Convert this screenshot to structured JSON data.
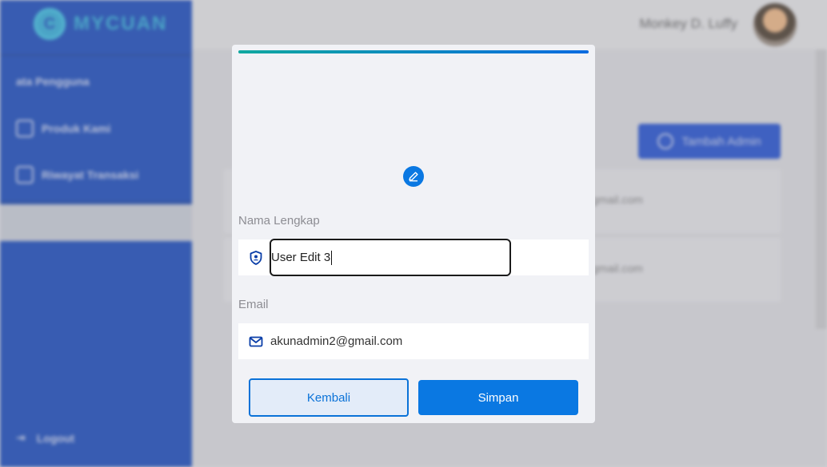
{
  "app": {
    "logo_letter": "C",
    "logo_text": "MYCUAN"
  },
  "sidebar": {
    "items": [
      {
        "label": "ata Pengguna",
        "icon": "users-icon"
      },
      {
        "label": "Produk Kami",
        "icon": "calendar-icon"
      },
      {
        "label": "Riwayat Transaksi",
        "icon": "history-icon"
      },
      {
        "label": "",
        "icon": "admin-icon"
      }
    ],
    "logout_label": "Logout"
  },
  "header": {
    "user_name": "Monkey D. Luffy"
  },
  "main": {
    "add_admin_label": "Tambah Admin",
    "rows": [
      {
        "email_fragment": "gmail.com"
      },
      {
        "email_fragment": "gmail.com"
      }
    ]
  },
  "modal": {
    "name_label": "Nama Lengkap",
    "name_value": "User Edit 3",
    "email_label": "Email",
    "email_value": "akunadmin2@gmail.com",
    "back_label": "Kembali",
    "save_label": "Simpan"
  },
  "colors": {
    "primary": "#0a78e2",
    "sidebar": "#0038b8",
    "accent_gradient_start": "#10a8a0"
  }
}
